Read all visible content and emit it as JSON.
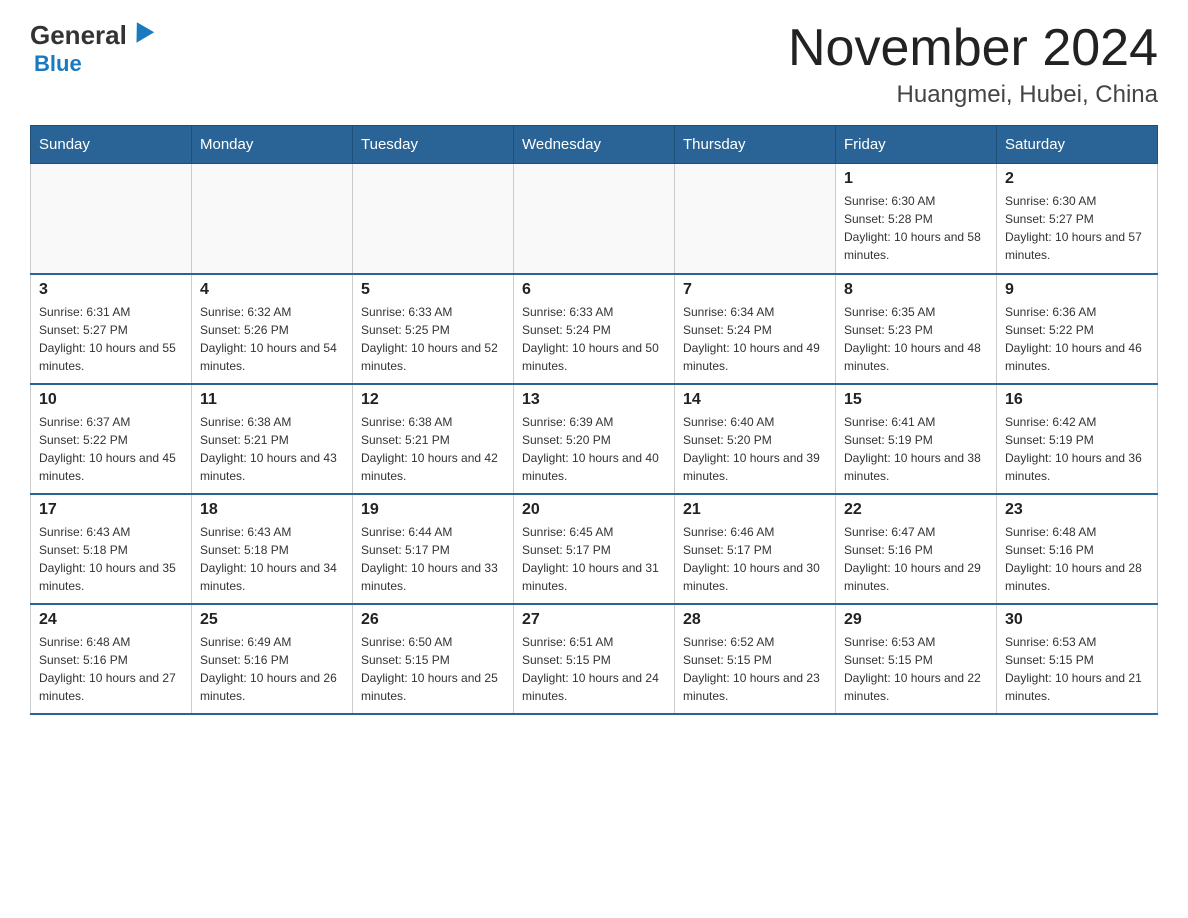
{
  "header": {
    "logo_general": "General",
    "logo_blue": "Blue",
    "title": "November 2024",
    "subtitle": "Huangmei, Hubei, China"
  },
  "days_of_week": [
    "Sunday",
    "Monday",
    "Tuesday",
    "Wednesday",
    "Thursday",
    "Friday",
    "Saturday"
  ],
  "weeks": [
    [
      {
        "num": "",
        "sunrise": "",
        "sunset": "",
        "daylight": ""
      },
      {
        "num": "",
        "sunrise": "",
        "sunset": "",
        "daylight": ""
      },
      {
        "num": "",
        "sunrise": "",
        "sunset": "",
        "daylight": ""
      },
      {
        "num": "",
        "sunrise": "",
        "sunset": "",
        "daylight": ""
      },
      {
        "num": "",
        "sunrise": "",
        "sunset": "",
        "daylight": ""
      },
      {
        "num": "1",
        "sunrise": "Sunrise: 6:30 AM",
        "sunset": "Sunset: 5:28 PM",
        "daylight": "Daylight: 10 hours and 58 minutes."
      },
      {
        "num": "2",
        "sunrise": "Sunrise: 6:30 AM",
        "sunset": "Sunset: 5:27 PM",
        "daylight": "Daylight: 10 hours and 57 minutes."
      }
    ],
    [
      {
        "num": "3",
        "sunrise": "Sunrise: 6:31 AM",
        "sunset": "Sunset: 5:27 PM",
        "daylight": "Daylight: 10 hours and 55 minutes."
      },
      {
        "num": "4",
        "sunrise": "Sunrise: 6:32 AM",
        "sunset": "Sunset: 5:26 PM",
        "daylight": "Daylight: 10 hours and 54 minutes."
      },
      {
        "num": "5",
        "sunrise": "Sunrise: 6:33 AM",
        "sunset": "Sunset: 5:25 PM",
        "daylight": "Daylight: 10 hours and 52 minutes."
      },
      {
        "num": "6",
        "sunrise": "Sunrise: 6:33 AM",
        "sunset": "Sunset: 5:24 PM",
        "daylight": "Daylight: 10 hours and 50 minutes."
      },
      {
        "num": "7",
        "sunrise": "Sunrise: 6:34 AM",
        "sunset": "Sunset: 5:24 PM",
        "daylight": "Daylight: 10 hours and 49 minutes."
      },
      {
        "num": "8",
        "sunrise": "Sunrise: 6:35 AM",
        "sunset": "Sunset: 5:23 PM",
        "daylight": "Daylight: 10 hours and 48 minutes."
      },
      {
        "num": "9",
        "sunrise": "Sunrise: 6:36 AM",
        "sunset": "Sunset: 5:22 PM",
        "daylight": "Daylight: 10 hours and 46 minutes."
      }
    ],
    [
      {
        "num": "10",
        "sunrise": "Sunrise: 6:37 AM",
        "sunset": "Sunset: 5:22 PM",
        "daylight": "Daylight: 10 hours and 45 minutes."
      },
      {
        "num": "11",
        "sunrise": "Sunrise: 6:38 AM",
        "sunset": "Sunset: 5:21 PM",
        "daylight": "Daylight: 10 hours and 43 minutes."
      },
      {
        "num": "12",
        "sunrise": "Sunrise: 6:38 AM",
        "sunset": "Sunset: 5:21 PM",
        "daylight": "Daylight: 10 hours and 42 minutes."
      },
      {
        "num": "13",
        "sunrise": "Sunrise: 6:39 AM",
        "sunset": "Sunset: 5:20 PM",
        "daylight": "Daylight: 10 hours and 40 minutes."
      },
      {
        "num": "14",
        "sunrise": "Sunrise: 6:40 AM",
        "sunset": "Sunset: 5:20 PM",
        "daylight": "Daylight: 10 hours and 39 minutes."
      },
      {
        "num": "15",
        "sunrise": "Sunrise: 6:41 AM",
        "sunset": "Sunset: 5:19 PM",
        "daylight": "Daylight: 10 hours and 38 minutes."
      },
      {
        "num": "16",
        "sunrise": "Sunrise: 6:42 AM",
        "sunset": "Sunset: 5:19 PM",
        "daylight": "Daylight: 10 hours and 36 minutes."
      }
    ],
    [
      {
        "num": "17",
        "sunrise": "Sunrise: 6:43 AM",
        "sunset": "Sunset: 5:18 PM",
        "daylight": "Daylight: 10 hours and 35 minutes."
      },
      {
        "num": "18",
        "sunrise": "Sunrise: 6:43 AM",
        "sunset": "Sunset: 5:18 PM",
        "daylight": "Daylight: 10 hours and 34 minutes."
      },
      {
        "num": "19",
        "sunrise": "Sunrise: 6:44 AM",
        "sunset": "Sunset: 5:17 PM",
        "daylight": "Daylight: 10 hours and 33 minutes."
      },
      {
        "num": "20",
        "sunrise": "Sunrise: 6:45 AM",
        "sunset": "Sunset: 5:17 PM",
        "daylight": "Daylight: 10 hours and 31 minutes."
      },
      {
        "num": "21",
        "sunrise": "Sunrise: 6:46 AM",
        "sunset": "Sunset: 5:17 PM",
        "daylight": "Daylight: 10 hours and 30 minutes."
      },
      {
        "num": "22",
        "sunrise": "Sunrise: 6:47 AM",
        "sunset": "Sunset: 5:16 PM",
        "daylight": "Daylight: 10 hours and 29 minutes."
      },
      {
        "num": "23",
        "sunrise": "Sunrise: 6:48 AM",
        "sunset": "Sunset: 5:16 PM",
        "daylight": "Daylight: 10 hours and 28 minutes."
      }
    ],
    [
      {
        "num": "24",
        "sunrise": "Sunrise: 6:48 AM",
        "sunset": "Sunset: 5:16 PM",
        "daylight": "Daylight: 10 hours and 27 minutes."
      },
      {
        "num": "25",
        "sunrise": "Sunrise: 6:49 AM",
        "sunset": "Sunset: 5:16 PM",
        "daylight": "Daylight: 10 hours and 26 minutes."
      },
      {
        "num": "26",
        "sunrise": "Sunrise: 6:50 AM",
        "sunset": "Sunset: 5:15 PM",
        "daylight": "Daylight: 10 hours and 25 minutes."
      },
      {
        "num": "27",
        "sunrise": "Sunrise: 6:51 AM",
        "sunset": "Sunset: 5:15 PM",
        "daylight": "Daylight: 10 hours and 24 minutes."
      },
      {
        "num": "28",
        "sunrise": "Sunrise: 6:52 AM",
        "sunset": "Sunset: 5:15 PM",
        "daylight": "Daylight: 10 hours and 23 minutes."
      },
      {
        "num": "29",
        "sunrise": "Sunrise: 6:53 AM",
        "sunset": "Sunset: 5:15 PM",
        "daylight": "Daylight: 10 hours and 22 minutes."
      },
      {
        "num": "30",
        "sunrise": "Sunrise: 6:53 AM",
        "sunset": "Sunset: 5:15 PM",
        "daylight": "Daylight: 10 hours and 21 minutes."
      }
    ]
  ]
}
